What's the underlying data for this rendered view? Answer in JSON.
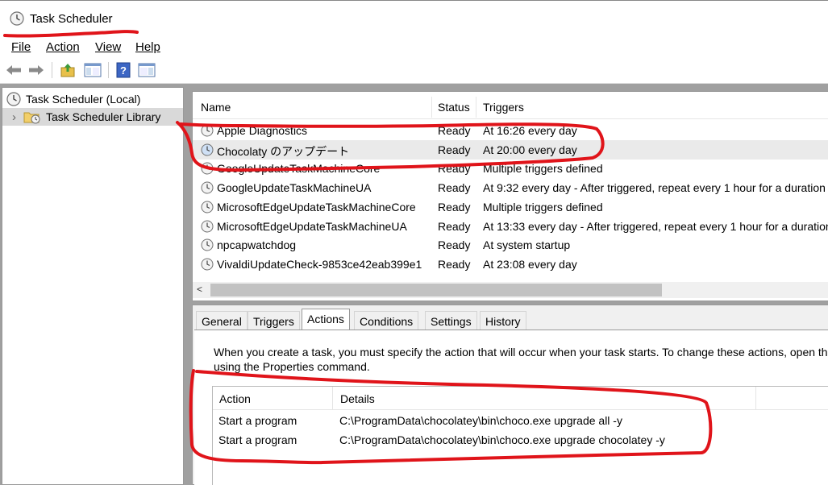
{
  "window": {
    "title": "Task Scheduler",
    "icon": "clock-icon"
  },
  "menu": {
    "file": "File",
    "action": "Action",
    "view": "View",
    "help": "Help"
  },
  "toolbar": {
    "back_icon": "back-arrow-icon",
    "forward_icon": "forward-arrow-icon",
    "up_icon": "up-folder-icon",
    "show_hide_icon": "show-hide-console-tree-icon",
    "help_icon": "help-icon",
    "action_pane_icon": "show-hide-action-pane-icon"
  },
  "tree": {
    "root_label": "Task Scheduler (Local)",
    "library_label": "Task Scheduler Library",
    "expand_glyph": "›"
  },
  "task_list": {
    "columns": [
      "Name",
      "Status",
      "Triggers"
    ],
    "rows": [
      {
        "name": "Apple Diagnostics",
        "status": "Ready",
        "triggers": "At 16:26 every day"
      },
      {
        "name": "Chocolaty のアップデート",
        "status": "Ready",
        "triggers": "At 20:00 every day"
      },
      {
        "name": "GoogleUpdateTaskMachineCore",
        "status": "Ready",
        "triggers": "Multiple triggers defined"
      },
      {
        "name": "GoogleUpdateTaskMachineUA",
        "status": "Ready",
        "triggers": "At 9:32 every day - After triggered, repeat every 1 hour for a duration"
      },
      {
        "name": "MicrosoftEdgeUpdateTaskMachineCore",
        "status": "Ready",
        "triggers": "Multiple triggers defined"
      },
      {
        "name": "MicrosoftEdgeUpdateTaskMachineUA",
        "status": "Ready",
        "triggers": "At 13:33 every day - After triggered, repeat every 1 hour for a duration"
      },
      {
        "name": "npcapwatchdog",
        "status": "Ready",
        "triggers": "At system startup"
      },
      {
        "name": "VivaldiUpdateCheck-9853ce42eab399e1",
        "status": "Ready",
        "triggers": "At 23:08 every day"
      }
    ],
    "scroll_left_glyph": "<"
  },
  "tabs": [
    "General",
    "Triggers",
    "Actions",
    "Conditions",
    "Settings",
    "History"
  ],
  "active_tab": "Actions",
  "actions_tab": {
    "description_line1": "When you create a task, you must specify the action that will occur when your task starts.  To change these actions, open the task property pages",
    "description_line2": "using the Properties command.",
    "columns": [
      "Action",
      "Details"
    ],
    "rows": [
      {
        "action": "Start a program",
        "details": "C:\\ProgramData\\chocolatey\\bin\\choco.exe upgrade all -y"
      },
      {
        "action": "Start a program",
        "details": "C:\\ProgramData\\chocolatey\\bin\\choco.exe upgrade chocolatey -y"
      }
    ]
  },
  "colors": {
    "annotation_red": "#e0141a",
    "selection_gray": "#eaeaea",
    "frame_gray": "#a0a0a0"
  }
}
